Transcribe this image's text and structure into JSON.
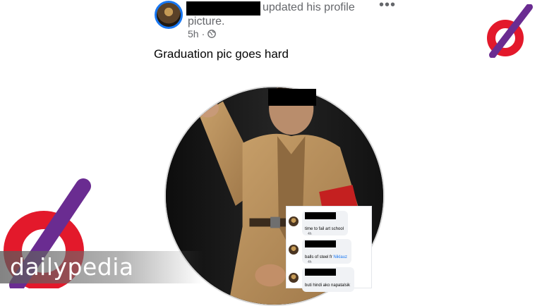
{
  "post": {
    "action_text": "updated his profile",
    "action_cont": "picture.",
    "time": "5h",
    "more_label": "•••",
    "caption": "Graduation pic goes hard"
  },
  "comments": [
    {
      "text": "time to fail art school",
      "time": "4h"
    },
    {
      "text": "balls of steel fr ",
      "link": "Niklauz",
      "time": "4h"
    },
    {
      "text": "buti hindi ako napatalsik",
      "time": "4h"
    }
  ],
  "brand": {
    "name": "dailypedia",
    "colors": {
      "red": "#e3192b",
      "purple": "#6a2c91",
      "band": "#6e6e6e"
    }
  },
  "icons": [
    "globe-icon",
    "more-icon"
  ]
}
